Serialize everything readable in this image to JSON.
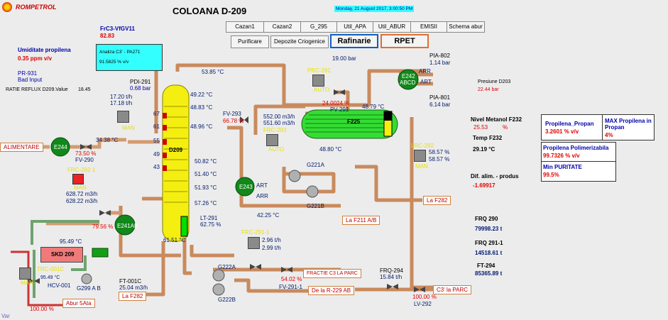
{
  "header": {
    "logo_text": "ROMPETROL",
    "title": "COLOANA D-209",
    "datetime": "Monday, 21 August 2017, 3:00:50 PM"
  },
  "nav": {
    "row1": [
      "Cazan1",
      "Cazan2",
      "G_295",
      "Util_APA",
      "Util_ABUR",
      "EMISII",
      "Schema abur"
    ],
    "purificare": "Purificare",
    "depozite": "Depozite Criogenice",
    "rafinarie": "Rafinarie",
    "rpet": "RPET"
  },
  "left": {
    "frc": "FrC3-VfGV11",
    "frc_val": "82.83",
    "analiza_label": "Analiza C3' - PA271",
    "analiza_val": "91.5825 % v/v",
    "umid_label": "Umiditate propilena",
    "umid_val": "0.35 ppm v/v",
    "pr931": "PR-931",
    "pr931_state": "Bad Input",
    "reflux_label": "RATIE REFLUX D209.Value",
    "reflux_val": "18.45",
    "pdi291": "PDI-291",
    "pdi291_val": "0.68 bar",
    "flow1": "17.20 t/h",
    "flow2": "17.18 t/h",
    "man1": "MAN",
    "alimentare": "ALIMENTARE",
    "e244": "E244",
    "fv290_pct": "73.50 %",
    "fv290": "FV-290",
    "temp_feed": "34.38 °C",
    "frc2921": "FRC-292-1",
    "man2": "MAN",
    "flow3": "628.72 m3/h",
    "flow4": "628.22 m3/h",
    "pct7956": "79.56 %",
    "e241ab": "E241AB",
    "t9549": "95.49 °C",
    "skd": "SKD 209",
    "trc001c": "TRC-001C",
    "t9549b": "95.49 °C",
    "hcv001": "HCV-001",
    "man3": "MAN",
    "g299": "G299 A B",
    "pct100": "100.00 %",
    "abur": "Abur 5Ata",
    "var": "Var"
  },
  "column": {
    "trays": [
      "67",
      "61",
      "55",
      "49",
      "43"
    ],
    "name": "D209",
    "temps": [
      "53.85 °C",
      "49.22 °C",
      "48.83 °C",
      "48.96 °C",
      "50.82 °C",
      "51.40 °C",
      "51.93 °C",
      "57.26 °C",
      "61.51 °C"
    ],
    "lt291": "LT-291",
    "lt291_val": "62.75 %",
    "ft001c": "FT-001C",
    "ft001c_val": "25.04 m3/h",
    "laf282": "La F282"
  },
  "center": {
    "fv293": "FV-293",
    "fv293_pct": "66.78 %",
    "f1": "552.00 m3/h",
    "f2": "551.60 m3/h",
    "frc293": "FRC-293",
    "auto1": "AUTO",
    "e243": "E243",
    "art": "ART",
    "arr": "ARR",
    "t4225": "42.25 °C",
    "laf211": "La F211 A/B",
    "prc291": "PRC-291",
    "auto2": "AUTO",
    "p1900": "19.00 bar",
    "pv291_pct": "24.0024 %",
    "pv291": "PV-291",
    "t4879": "48.79 °C",
    "f225": "F225",
    "t4880": "48.80 °C",
    "g221a": "G221A",
    "g221b": "G221B",
    "frc2911": "FRC-291-1",
    "f296": "2.96 t/h",
    "f299": "2.99 t/h",
    "fractie": "FRACTIE C3 LA PARC",
    "pct5402": "54.02 %",
    "fv2911": "FV-291-1",
    "g222a": "G222A",
    "g222b": "G222B",
    "delar229": "De la R-229 AB"
  },
  "right": {
    "pia802": "PIA-802",
    "pia802_val": "1.14 bar",
    "pia801": "PIA-801",
    "pia801_val": "6.14 bar",
    "e242": "E242",
    "abcd": "ABCD",
    "arr": "ARR",
    "art": "ART",
    "presiune": "Presiune D203",
    "presiune_val": "22.44 bar",
    "lrc292": "LRC-292",
    "l1": "58.57 %",
    "l2": "58.57 %",
    "man": "MAN",
    "laf282": "La F282",
    "nivel_label": "Nivel Metanol F232",
    "nivel_val": "25.53",
    "nivel_unit": "%",
    "temp_label": "Temp F232",
    "temp_val": "29.19 °C",
    "dif_label": "Dif. alim. - produs",
    "dif_val": "-1.69917",
    "frq290": "FRQ 290",
    "frq290_val": "79998.23 t",
    "frq2911": "FRQ 291-1",
    "frq2911_val": "14518.61 t",
    "ft294": "FT-294",
    "ft294_val": "85365.89 t",
    "frq294": "FRQ-294",
    "frq294_val": "15.84 t/h",
    "c3parc": "C3' la PARC",
    "pct100": "100.00 %",
    "lv292": "LV-292",
    "box1_label": "Propilena_Propan",
    "box1_val": "3.2601 % v/v",
    "box2_label": "MAX Propilena in Propan",
    "box2_val": "4%",
    "box3_label": "Propilena Polimerizabila",
    "box3_val": "99.7326 % v/v",
    "box4_label": "Min PURITATE",
    "box4_val": "99.5%"
  }
}
